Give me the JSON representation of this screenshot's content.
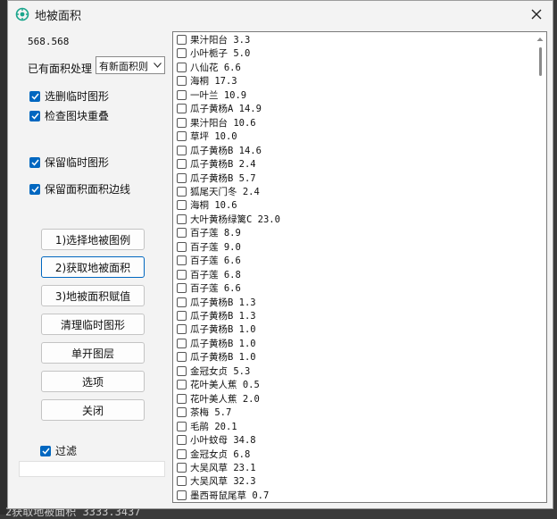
{
  "background": {
    "status_text": "2获取地被面积 3333.3437"
  },
  "window": {
    "title": "地被面积",
    "area_value": "568.568",
    "process_label": "已有面积处理",
    "process_select_value": "有新面积则",
    "checkboxes": [
      {
        "label": "选删临时图形",
        "checked": true
      },
      {
        "label": "检查图块重叠",
        "checked": true
      },
      {
        "label": "保留临时图形",
        "checked": true
      },
      {
        "label": "保留面积面积边线",
        "checked": true
      }
    ],
    "buttons": [
      "1)选择地被图例",
      "2)获取地被面积",
      "3)地被面积赋值",
      "清理临时图形",
      "单开图层",
      "选项",
      "关闭"
    ],
    "filter": {
      "label": "过滤",
      "checked": true
    }
  },
  "plant_list": [
    {
      "label": "果汁阳台 3.3"
    },
    {
      "label": "小叶栀子 5.0"
    },
    {
      "label": "八仙花 6.6"
    },
    {
      "label": "海桐 17.3"
    },
    {
      "label": "一叶兰 10.9"
    },
    {
      "label": "瓜子黄杨A 14.9"
    },
    {
      "label": "果汁阳台 10.6"
    },
    {
      "label": "草坪 10.0"
    },
    {
      "label": "瓜子黄杨B 14.6"
    },
    {
      "label": "瓜子黄杨B 2.4"
    },
    {
      "label": "瓜子黄杨B 5.7"
    },
    {
      "label": "狐尾天门冬 2.4"
    },
    {
      "label": "海桐 10.6"
    },
    {
      "label": "大叶黄杨绿篱C 23.0"
    },
    {
      "label": "百子莲 8.9"
    },
    {
      "label": "百子莲 9.0"
    },
    {
      "label": "百子莲 6.6"
    },
    {
      "label": "百子莲 6.8"
    },
    {
      "label": "百子莲 6.6"
    },
    {
      "label": "瓜子黄杨B 1.3"
    },
    {
      "label": "瓜子黄杨B 1.3"
    },
    {
      "label": "瓜子黄杨B 1.0"
    },
    {
      "label": "瓜子黄杨B 1.0"
    },
    {
      "label": "瓜子黄杨B 1.0"
    },
    {
      "label": "金冠女贞 5.3"
    },
    {
      "label": "花叶美人蕉 0.5"
    },
    {
      "label": "花叶美人蕉 2.0"
    },
    {
      "label": "茶梅 5.7"
    },
    {
      "label": "毛鹃 20.1"
    },
    {
      "label": "小叶蚊母 34.8"
    },
    {
      "label": "金冠女贞 6.8"
    },
    {
      "label": "大吴风草 23.1"
    },
    {
      "label": "大吴风草 32.3"
    },
    {
      "label": "墨西哥鼠尾草 0.7"
    }
  ]
}
